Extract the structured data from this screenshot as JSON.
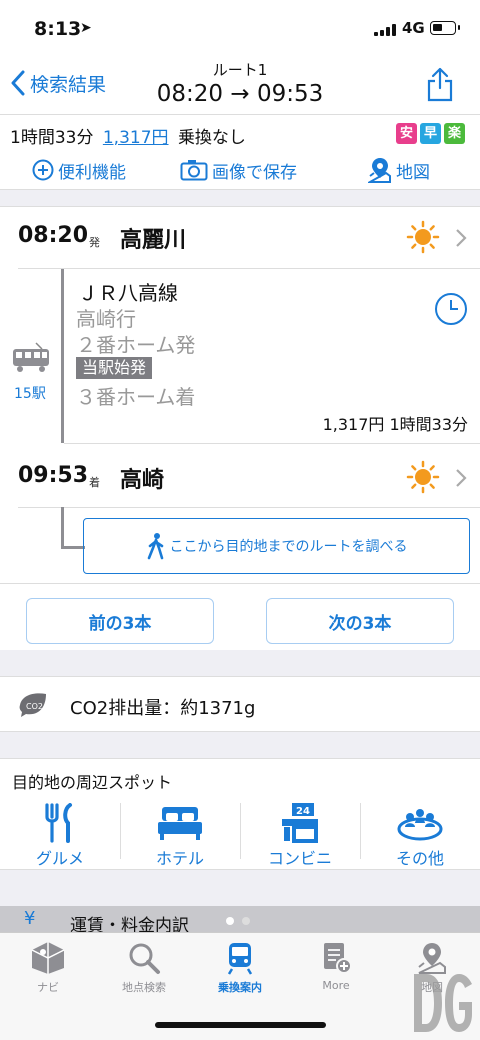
{
  "status_bar": {
    "time": "8:13",
    "network": "4G"
  },
  "nav": {
    "back_label": "検索結果",
    "title": "ルート1",
    "time_range": "08:20 → 09:53"
  },
  "summary": {
    "duration": "1時間33分",
    "fare": "1,317円",
    "transfers": "乗換なし",
    "badges": [
      {
        "label": "安",
        "color": "#e83e8c"
      },
      {
        "label": "早",
        "color": "#26a6e0"
      },
      {
        "label": "楽",
        "color": "#4cba3c"
      }
    ],
    "tools": {
      "convenient": "便利機能",
      "save_image": "画像で保存",
      "map": "地図"
    }
  },
  "route": {
    "departure": {
      "time": "08:20",
      "kind": "発",
      "station": "高麗川",
      "weather_icon": "sun-icon"
    },
    "leg": {
      "line": "ＪＲ八高線",
      "destination": "高崎行",
      "dep_platform": "２番ホーム発",
      "origin_tag": "当駅始発",
      "arr_platform": "３番ホーム着",
      "fare_time": "1,317円 1時間33分",
      "stations": "15駅"
    },
    "arrival": {
      "time": "09:53",
      "kind": "着",
      "station": "高崎",
      "weather_icon": "sun-icon"
    },
    "walk_button": "ここから目的地までのルートを調べる"
  },
  "prev_next": {
    "prev": "前の3本",
    "next": "次の3本"
  },
  "co2": {
    "icon_label": "CO2",
    "text": "CO2排出量：約1371g"
  },
  "spots": {
    "heading": "目的地の周辺スポット",
    "items": [
      {
        "label": "グルメ",
        "icon": "gourmet-icon"
      },
      {
        "label": "ホテル",
        "icon": "hotel-icon"
      },
      {
        "label": "コンビニ",
        "icon": "convenience-store-icon",
        "badge": "24"
      },
      {
        "label": "その他",
        "icon": "other-icon"
      }
    ]
  },
  "fare_detail": {
    "yen": "¥",
    "title": "運賃・料金内訳"
  },
  "tabbar": {
    "items": [
      {
        "label": "ナビ",
        "active": false
      },
      {
        "label": "地点検索",
        "active": false
      },
      {
        "label": "乗換案内",
        "active": true
      },
      {
        "label": "More",
        "active": false
      },
      {
        "label": "地図",
        "active": false
      }
    ]
  }
}
